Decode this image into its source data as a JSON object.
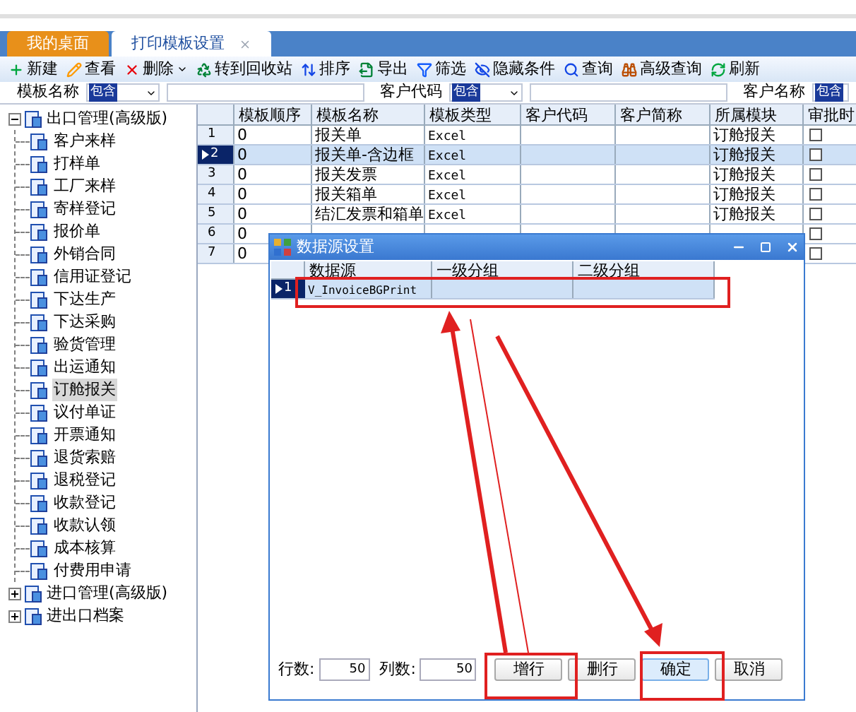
{
  "tabs": [
    {
      "label": "我的桌面",
      "selected": false,
      "closable": false
    },
    {
      "label": "打印模板设置",
      "selected": true,
      "closable": true
    }
  ],
  "toolbar": [
    {
      "label": "新建",
      "dropdown": false
    },
    {
      "label": "查看",
      "dropdown": false
    },
    {
      "label": "删除",
      "dropdown": true
    },
    {
      "label": "转到回收站",
      "dropdown": false
    },
    {
      "label": "排序",
      "dropdown": false
    },
    {
      "label": "导出",
      "dropdown": false
    },
    {
      "label": "筛选",
      "dropdown": false
    },
    {
      "label": "隐藏条件",
      "dropdown": false
    },
    {
      "label": "查询",
      "dropdown": false
    },
    {
      "label": "高级查询",
      "dropdown": false
    },
    {
      "label": "刷新",
      "dropdown": false
    }
  ],
  "filters": [
    {
      "label": "模板名称",
      "operator": "包含"
    },
    {
      "label": "客户代码",
      "operator": "包含"
    },
    {
      "label": "客户名称",
      "operator": "包含"
    }
  ],
  "tree": [
    {
      "label": "出口管理(高级版)",
      "expanded": true,
      "selected": false,
      "children": [
        {
          "label": "客户来样",
          "selected": false
        },
        {
          "label": "打样单",
          "selected": false
        },
        {
          "label": "工厂来样",
          "selected": false
        },
        {
          "label": "寄样登记",
          "selected": false
        },
        {
          "label": "报价单",
          "selected": false
        },
        {
          "label": "外销合同",
          "selected": false
        },
        {
          "label": "信用证登记",
          "selected": false
        },
        {
          "label": "下达生产",
          "selected": false
        },
        {
          "label": "下达采购",
          "selected": false
        },
        {
          "label": "验货管理",
          "selected": false
        },
        {
          "label": "出运通知",
          "selected": false
        },
        {
          "label": "订舱报关",
          "selected": true
        },
        {
          "label": "议付单证",
          "selected": false
        },
        {
          "label": "开票通知",
          "selected": false
        },
        {
          "label": "退货索赔",
          "selected": false
        },
        {
          "label": "退税登记",
          "selected": false
        },
        {
          "label": "收款登记",
          "selected": false
        },
        {
          "label": "收款认领",
          "selected": false
        },
        {
          "label": "成本核算",
          "selected": false
        },
        {
          "label": "付费用申请",
          "selected": false
        }
      ]
    },
    {
      "label": "进口管理(高级版)",
      "expanded": false,
      "selected": false
    },
    {
      "label": "进出口档案",
      "expanded": false,
      "selected": false
    }
  ],
  "table": {
    "columns": [
      "模板顺序",
      "模板名称",
      "模板类型",
      "客户代码",
      "客户简称",
      "所属模块",
      "审批时"
    ],
    "rows": [
      {
        "number": "1",
        "order": "0",
        "name": "报关单",
        "type": "Excel",
        "module": "订舱报关",
        "checked": false,
        "selected": false
      },
      {
        "number": "2",
        "order": "0",
        "name": "报关单-含边框",
        "type": "Excel",
        "module": "订舱报关",
        "checked": false,
        "selected": true
      },
      {
        "number": "3",
        "order": "0",
        "name": "报关发票",
        "type": "Excel",
        "module": "订舱报关",
        "checked": false,
        "selected": false
      },
      {
        "number": "4",
        "order": "0",
        "name": "报关箱单",
        "type": "Excel",
        "module": "订舱报关",
        "checked": false,
        "selected": false
      },
      {
        "number": "5",
        "order": "0",
        "name": "结汇发票和箱单",
        "type": "Excel",
        "module": "订舱报关",
        "checked": false,
        "selected": false
      },
      {
        "number": "6",
        "order": "0",
        "checked": false,
        "selected": false
      },
      {
        "number": "7",
        "order": "0",
        "checked": false,
        "selected": false
      }
    ]
  },
  "dialog": {
    "title": "数据源设置",
    "columns": [
      "数据源",
      "一级分组",
      "二级分组"
    ],
    "rows": [
      {
        "number": "1",
        "source": "V_InvoiceBGPrint",
        "selected": true
      }
    ],
    "rows_label": "行数:",
    "rows_value": "50",
    "cols_label": "列数:",
    "cols_value": "50",
    "buttons": [
      {
        "label": "增行",
        "primary": false
      },
      {
        "label": "删行",
        "primary": false
      },
      {
        "label": "确定",
        "primary": true
      },
      {
        "label": "取消",
        "primary": false
      }
    ]
  }
}
